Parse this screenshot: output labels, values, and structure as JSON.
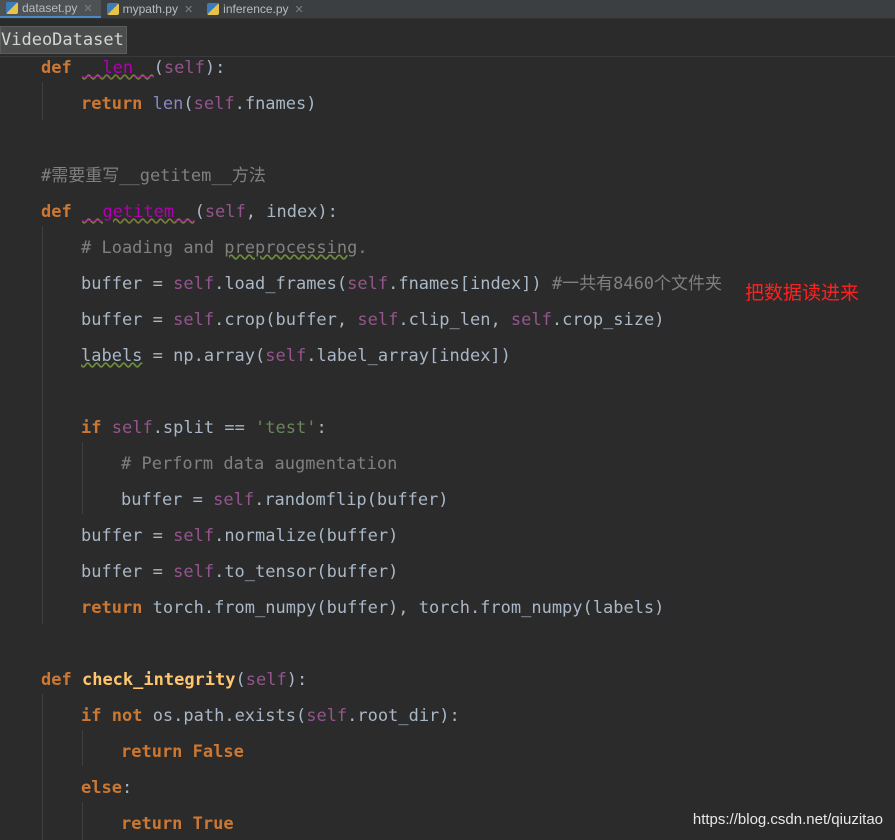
{
  "tabs": [
    {
      "label": "dataset.py",
      "active": true
    },
    {
      "label": "mypath.py",
      "active": false
    },
    {
      "label": "inference.py",
      "active": false
    }
  ],
  "breadcrumb": "VideoDataset",
  "code": {
    "l1": {
      "kw": "def",
      "name": "__len__",
      "open": "(",
      "self": "self",
      "close": "):"
    },
    "l2": {
      "kw": "return",
      "builtin": "len",
      "open": "(",
      "self": "self",
      "rest": ".fnames)"
    },
    "l3": {
      "comment": "#需要重写__getitem__方法"
    },
    "l4": {
      "kw": "def",
      "name": "__getitem__",
      "open": "(",
      "self": "self",
      "rest": ", index):"
    },
    "l5": {
      "comment_a": "# Loading and ",
      "comment_b": "preprocessing",
      "comment_c": "."
    },
    "l6": {
      "a": "buffer = ",
      "self1": "self",
      "b": ".load_frames(",
      "self2": "self",
      "c": ".fnames[index]) ",
      "comment": "#一共有8460个文件夹"
    },
    "l7": {
      "a": "buffer = ",
      "self1": "self",
      "b": ".crop(buffer, ",
      "self2": "self",
      "c": ".clip_len, ",
      "self3": "self",
      "d": ".crop_size)"
    },
    "l8": {
      "var": "labels",
      "a": " = np.array(",
      "self1": "self",
      "b": ".label_array[index])"
    },
    "l9": {
      "kw": "if",
      "self": "self",
      "a": ".split == ",
      "str": "'test'",
      "b": ":"
    },
    "l10": {
      "comment": "# Perform data augmentation"
    },
    "l11": {
      "a": "buffer = ",
      "self": "self",
      "b": ".randomflip(buffer)"
    },
    "l12": {
      "a": "buffer = ",
      "self": "self",
      "b": ".normalize(buffer)"
    },
    "l13": {
      "a": "buffer = ",
      "self": "self",
      "b": ".to_tensor(buffer)"
    },
    "l14": {
      "kw": "return",
      "a": " torch.from_numpy(buffer), torch.from_numpy(labels)"
    },
    "l15": {
      "kw": "def",
      "name": "check_integrity",
      "open": "(",
      "self": "self",
      "close": "):"
    },
    "l16": {
      "kw1": "if",
      "kw2": "not",
      "a": " os.path.exists(",
      "self": "self",
      "b": ".root_dir):"
    },
    "l17": {
      "kw1": "return",
      "kw2": "False"
    },
    "l18": {
      "kw": "else",
      "b": ":"
    },
    "l19": {
      "kw1": "return",
      "kw2": "True"
    }
  },
  "annotation": "把数据读进来",
  "watermark": "https://blog.csdn.net/qiuzitao"
}
